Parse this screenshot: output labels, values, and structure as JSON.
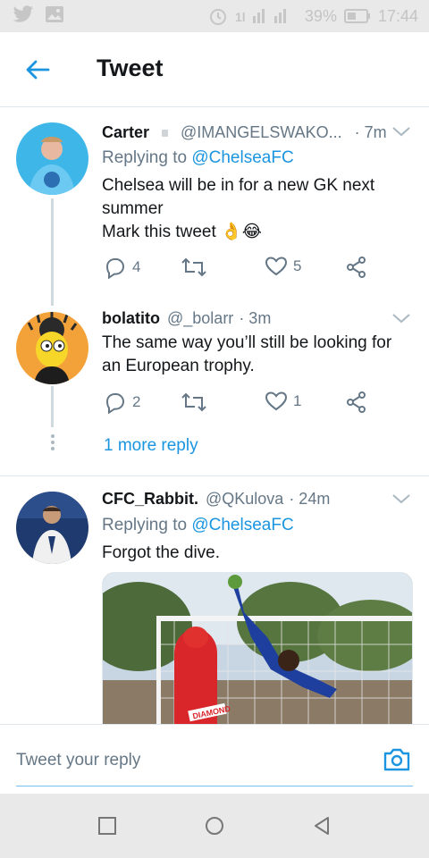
{
  "status_bar": {
    "battery": "39%",
    "time": "17:44",
    "icons": [
      "twitter-icon",
      "image-icon",
      "alarm-icon",
      "signal-icon",
      "battery-icon"
    ]
  },
  "header": {
    "title": "Tweet",
    "back_icon": "arrow-left-icon"
  },
  "tweets": [
    {
      "name": "Carter",
      "handle": "@IMANGELSWAKO...",
      "time": "· 7m",
      "replying_prefix": "Replying to ",
      "replying_to": "@ChelseaFC",
      "text_lines": [
        "Chelsea will be in for a new GK next",
        "summer",
        "Mark this tweet 👌😂"
      ],
      "replies": "4",
      "retweets": "",
      "likes": "5"
    },
    {
      "name": "bolatito",
      "handle": "@_bolarr",
      "time": "· 3m",
      "text_lines": [
        "The same way you’ll still be looking for",
        "an European trophy."
      ],
      "replies": "2",
      "retweets": "",
      "likes": "1"
    },
    {
      "name": "CFC_Rabbit.",
      "handle": "@QKulova",
      "time": "· 24m",
      "replying_prefix": "Replying to ",
      "replying_to": "@ChelseaFC",
      "text_lines": [
        "Forgot the dive."
      ],
      "media_text": "DIAMOND"
    }
  ],
  "more_reply": "1 more reply",
  "composer": {
    "placeholder": "Tweet your reply",
    "camera_icon": "camera-icon"
  },
  "colors": {
    "accent": "#1b95e0",
    "secondary_text": "#657786",
    "divider": "#e1e8ed"
  }
}
